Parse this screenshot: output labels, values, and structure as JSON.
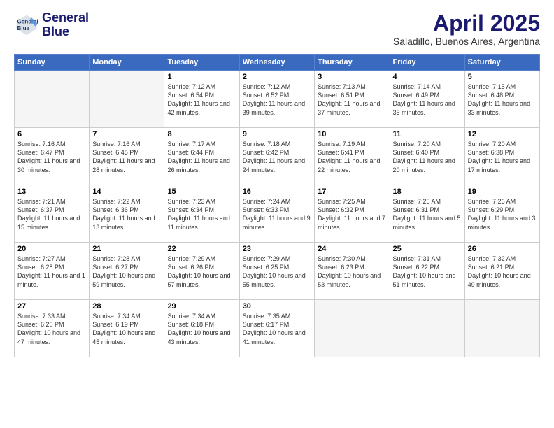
{
  "header": {
    "logo": {
      "line1": "General",
      "line2": "Blue"
    },
    "title": "April 2025",
    "subtitle": "Saladillo, Buenos Aires, Argentina"
  },
  "weekdays": [
    "Sunday",
    "Monday",
    "Tuesday",
    "Wednesday",
    "Thursday",
    "Friday",
    "Saturday"
  ],
  "weeks": [
    [
      {
        "day": null
      },
      {
        "day": null
      },
      {
        "day": "1",
        "sunrise": "7:12 AM",
        "sunset": "6:54 PM",
        "daylight": "11 hours and 42 minutes."
      },
      {
        "day": "2",
        "sunrise": "7:12 AM",
        "sunset": "6:52 PM",
        "daylight": "11 hours and 39 minutes."
      },
      {
        "day": "3",
        "sunrise": "7:13 AM",
        "sunset": "6:51 PM",
        "daylight": "11 hours and 37 minutes."
      },
      {
        "day": "4",
        "sunrise": "7:14 AM",
        "sunset": "6:49 PM",
        "daylight": "11 hours and 35 minutes."
      },
      {
        "day": "5",
        "sunrise": "7:15 AM",
        "sunset": "6:48 PM",
        "daylight": "11 hours and 33 minutes."
      }
    ],
    [
      {
        "day": "6",
        "sunrise": "7:16 AM",
        "sunset": "6:47 PM",
        "daylight": "11 hours and 30 minutes."
      },
      {
        "day": "7",
        "sunrise": "7:16 AM",
        "sunset": "6:45 PM",
        "daylight": "11 hours and 28 minutes."
      },
      {
        "day": "8",
        "sunrise": "7:17 AM",
        "sunset": "6:44 PM",
        "daylight": "11 hours and 26 minutes."
      },
      {
        "day": "9",
        "sunrise": "7:18 AM",
        "sunset": "6:42 PM",
        "daylight": "11 hours and 24 minutes."
      },
      {
        "day": "10",
        "sunrise": "7:19 AM",
        "sunset": "6:41 PM",
        "daylight": "11 hours and 22 minutes."
      },
      {
        "day": "11",
        "sunrise": "7:20 AM",
        "sunset": "6:40 PM",
        "daylight": "11 hours and 20 minutes."
      },
      {
        "day": "12",
        "sunrise": "7:20 AM",
        "sunset": "6:38 PM",
        "daylight": "11 hours and 17 minutes."
      }
    ],
    [
      {
        "day": "13",
        "sunrise": "7:21 AM",
        "sunset": "6:37 PM",
        "daylight": "11 hours and 15 minutes."
      },
      {
        "day": "14",
        "sunrise": "7:22 AM",
        "sunset": "6:36 PM",
        "daylight": "11 hours and 13 minutes."
      },
      {
        "day": "15",
        "sunrise": "7:23 AM",
        "sunset": "6:34 PM",
        "daylight": "11 hours and 11 minutes."
      },
      {
        "day": "16",
        "sunrise": "7:24 AM",
        "sunset": "6:33 PM",
        "daylight": "11 hours and 9 minutes."
      },
      {
        "day": "17",
        "sunrise": "7:25 AM",
        "sunset": "6:32 PM",
        "daylight": "11 hours and 7 minutes."
      },
      {
        "day": "18",
        "sunrise": "7:25 AM",
        "sunset": "6:31 PM",
        "daylight": "11 hours and 5 minutes."
      },
      {
        "day": "19",
        "sunrise": "7:26 AM",
        "sunset": "6:29 PM",
        "daylight": "11 hours and 3 minutes."
      }
    ],
    [
      {
        "day": "20",
        "sunrise": "7:27 AM",
        "sunset": "6:28 PM",
        "daylight": "11 hours and 1 minute."
      },
      {
        "day": "21",
        "sunrise": "7:28 AM",
        "sunset": "6:27 PM",
        "daylight": "10 hours and 59 minutes."
      },
      {
        "day": "22",
        "sunrise": "7:29 AM",
        "sunset": "6:26 PM",
        "daylight": "10 hours and 57 minutes."
      },
      {
        "day": "23",
        "sunrise": "7:29 AM",
        "sunset": "6:25 PM",
        "daylight": "10 hours and 55 minutes."
      },
      {
        "day": "24",
        "sunrise": "7:30 AM",
        "sunset": "6:23 PM",
        "daylight": "10 hours and 53 minutes."
      },
      {
        "day": "25",
        "sunrise": "7:31 AM",
        "sunset": "6:22 PM",
        "daylight": "10 hours and 51 minutes."
      },
      {
        "day": "26",
        "sunrise": "7:32 AM",
        "sunset": "6:21 PM",
        "daylight": "10 hours and 49 minutes."
      }
    ],
    [
      {
        "day": "27",
        "sunrise": "7:33 AM",
        "sunset": "6:20 PM",
        "daylight": "10 hours and 47 minutes."
      },
      {
        "day": "28",
        "sunrise": "7:34 AM",
        "sunset": "6:19 PM",
        "daylight": "10 hours and 45 minutes."
      },
      {
        "day": "29",
        "sunrise": "7:34 AM",
        "sunset": "6:18 PM",
        "daylight": "10 hours and 43 minutes."
      },
      {
        "day": "30",
        "sunrise": "7:35 AM",
        "sunset": "6:17 PM",
        "daylight": "10 hours and 41 minutes."
      },
      {
        "day": null
      },
      {
        "day": null
      },
      {
        "day": null
      }
    ]
  ]
}
